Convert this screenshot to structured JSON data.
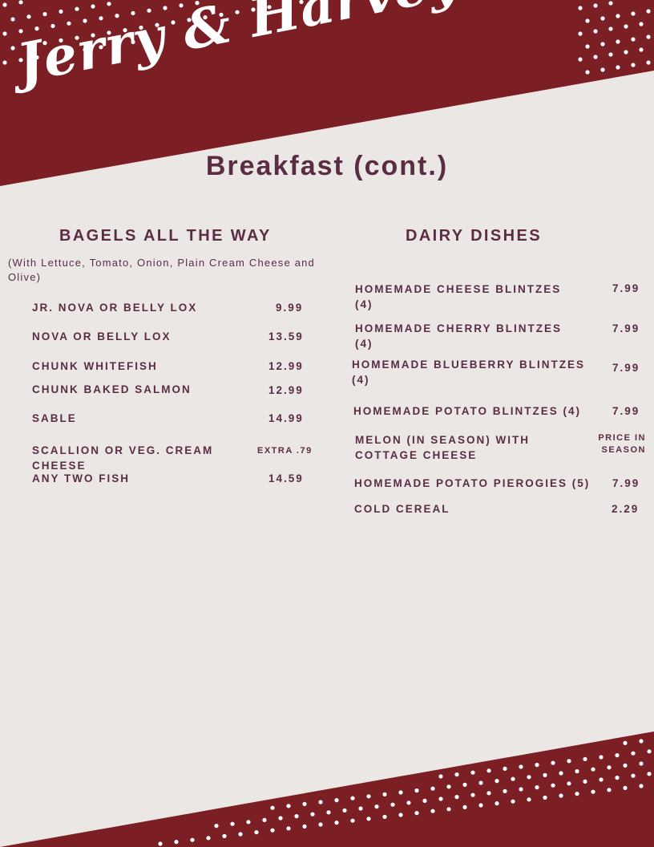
{
  "brand": {
    "logo_text": "Jerry & Harvey's"
  },
  "page": {
    "title": "Breakfast (cont.)"
  },
  "colors": {
    "banner": "#7b1f25",
    "background": "#ebe7e4",
    "text": "#5a2d45",
    "dots": "#ffffff"
  },
  "bagels": {
    "heading": "BAGELS ALL THE WAY",
    "note": "(With Lettuce, Tomato, Onion, Plain Cream Cheese and Olive)",
    "items": [
      {
        "name": "JR. NOVA OR BELLY LOX",
        "price": "9.99"
      },
      {
        "name": "NOVA OR BELLY LOX",
        "price": "13.59"
      },
      {
        "name": "CHUNK WHITEFISH",
        "price": "12.99"
      },
      {
        "name": "CHUNK BAKED SALMON",
        "price": "12.99"
      },
      {
        "name": "SABLE",
        "price": "14.99"
      },
      {
        "name": "SCALLION OR VEG. CREAM CHEESE",
        "price": "EXTRA .79"
      },
      {
        "name": "ANY TWO FISH",
        "price": "14.59"
      }
    ]
  },
  "dairy": {
    "heading": "DAIRY DISHES",
    "items": [
      {
        "name": "HOMEMADE CHEESE BLINTZES (4)",
        "price": "7.99"
      },
      {
        "name": "HOMEMADE CHERRY BLINTZES (4)",
        "price": "7.99"
      },
      {
        "name": "HOMEMADE BLUEBERRY BLINTZES (4)",
        "price": "7.99"
      },
      {
        "name": "HOMEMADE POTATO BLINTZES (4)",
        "price": "7.99"
      },
      {
        "name": "MELON (IN SEASON) WITH COTTAGE CHEESE",
        "price": "PRICE IN SEASON"
      },
      {
        "name": "HOMEMADE POTATO PIEROGIES (5)",
        "price": "7.99"
      },
      {
        "name": "COLD CEREAL",
        "price": "2.29"
      }
    ]
  }
}
